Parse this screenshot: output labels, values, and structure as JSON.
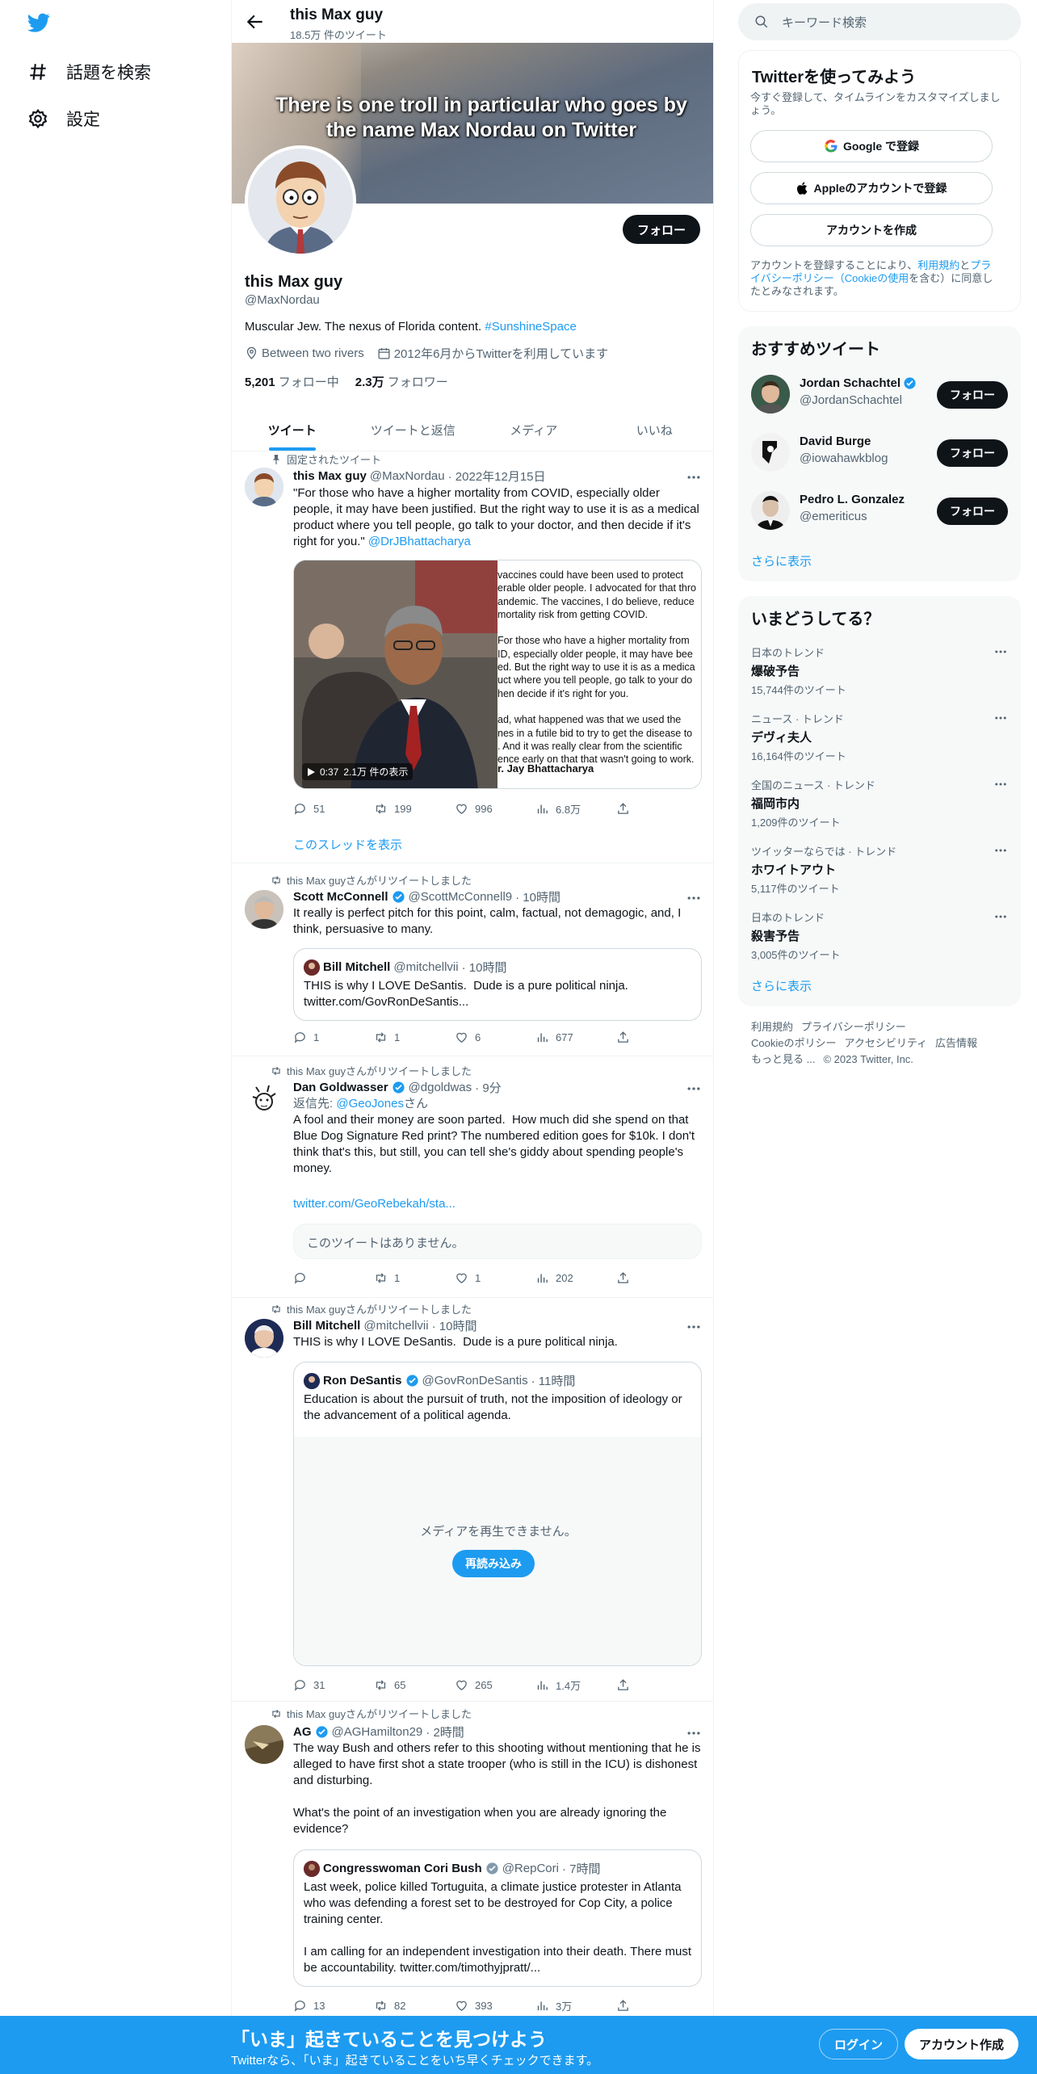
{
  "nav": {
    "explore_label": "話題を検索",
    "settings_label": "設定"
  },
  "profile": {
    "name": "this Max guy",
    "tweet_count": "18.5万 件のツイート",
    "banner_text": "There is one troll in particular who goes by the name Max Nordau on Twitter",
    "follow_label": "フォロー",
    "handle": "@MaxNordau",
    "bio_text": "Muscular Jew. The nexus of Florida content. ",
    "bio_hashtag": "#SunshineSpace",
    "location": "Between two rivers",
    "joined": "2012年6月からTwitterを利用しています",
    "following_count": "5,201",
    "following_label": "フォロー中",
    "followers_count": "2.3万",
    "followers_label": "フォロワー"
  },
  "tabs": [
    "ツイート",
    "ツイートと返信",
    "メディア",
    "いいね"
  ],
  "tweets": [
    {
      "context": "固定されたツイート",
      "name": "this Max guy",
      "handle": "@MaxNordau",
      "time": "· 2022年12月15日",
      "text": "\"For those who have a higher mortality from COVID, especially older people, it may have been justified. But the right way to use it is as a medical product where you tell people, go talk to your doctor, and then decide if it's right for you.\" ",
      "mention": "@DrJBhattacharya",
      "video_quote": "vaccines could have been used to protect\nerable older people. I advocated for that thro\nandemic. The vaccines, I do believe, reduce\nmortality risk from getting COVID.\n\nFor those who have a higher mortality from\nID, especially older people, it may have bee\ned. But the right way to use it is as a medica\nuct where you tell people, go talk to your do\nhen decide if it's right for you.\n\nad, what happened was that we used the\nnes in a futile bid to try to get the disease to\n. And it was really clear from the scientific\nence early on that that wasn't going to work.",
      "video_attrib": "r. Jay Bhattacharya",
      "video_time": "0:37",
      "video_views": "2.1万 件の表示",
      "replies": "51",
      "retweets": "199",
      "likes": "996",
      "views": "6.8万",
      "thread_link": "このスレッドを表示"
    },
    {
      "context": "this Max guyさんがリツイートしました",
      "name": "Scott McConnell",
      "handle": "@ScottMcConnell9",
      "time": "· 10時間",
      "text": "It really is perfect pitch for this point, calm, factual, not demagogic, and, I think, persuasive to many.",
      "quote_name": "Bill Mitchell",
      "quote_handle": "@mitchellvii",
      "quote_time": "· 10時間",
      "quote_text": "THIS is why I LOVE DeSantis.  Dude is a pure political ninja.\ntwitter.com/GovRonDeSantis...",
      "replies": "1",
      "retweets": "1",
      "likes": "6",
      "views": "677"
    },
    {
      "context": "this Max guyさんがリツイートしました",
      "name": "Dan Goldwasser",
      "handle": "@dgoldwas",
      "time": "· 9分",
      "reply_prefix": "返信先: ",
      "reply_to": "@GeoJones",
      "reply_suffix": "さん",
      "text": "A fool and their money are soon parted.  How much did she spend on that Blue Dog Signature Red print? The numbered edition goes for $10k. I don't think that's this, but still, you can tell she's giddy about spending people's money.",
      "link": "twitter.com/GeoRebekah/sta...",
      "unavailable": "このツイートはありません。",
      "replies": "",
      "retweets": "1",
      "likes": "1",
      "views": "202"
    },
    {
      "context": "this Max guyさんがリツイートしました",
      "name": "Bill Mitchell",
      "handle": "@mitchellvii",
      "time": "· 10時間",
      "text": "THIS is why I LOVE DeSantis.  Dude is a pure political ninja.",
      "quote_name": "Ron DeSantis",
      "quote_handle": "@GovRonDeSantis",
      "quote_time": "· 11時間",
      "quote_text": "Education is about the pursuit of truth, not the imposition of ideology or the advancement of a political agenda.",
      "media_error": "メディアを再生できません。",
      "reload_label": "再読み込み",
      "replies": "31",
      "retweets": "65",
      "likes": "265",
      "views": "1.4万"
    },
    {
      "context": "this Max guyさんがリツイートしました",
      "name": "AG",
      "handle": "@AGHamilton29",
      "time": "· 2時間",
      "text": "The way Bush and others refer to this shooting without mentioning that he is alleged to have first shot a state trooper (who is still in the ICU) is dishonest and disturbing.\n\nWhat's the point of an investigation when you are already ignoring the evidence?",
      "quote_name": "Congresswoman Cori Bush",
      "quote_handle": "@RepCori",
      "quote_time": "· 7時間",
      "quote_text": "Last week, police killed Tortuguita, a climate justice protester in Atlanta who was defending a forest set to be destroyed for Cop City, a police training center.\n\nI am calling for an independent investigation into their death. There must be accountability. twitter.com/timothyjpratt/...",
      "replies": "13",
      "retweets": "82",
      "likes": "393",
      "views": "3万"
    }
  ],
  "right": {
    "search_placeholder": "キーワード検索",
    "signup_title": "Twitterを使ってみよう",
    "signup_sub": "今すぐ登録して、タイムラインをカスタマイズしましょう。",
    "google_label": "Google で登録",
    "apple_label": "Appleのアカウントで登録",
    "create_label": "アカウントを作成",
    "terms_pre": "アカウントを登録することにより、",
    "terms_link1": "利用規約",
    "terms_mid": "と",
    "terms_link2": "プライバシーポリシー（Cookieの使用",
    "terms_post": "を含む）に同意したとみなされます。",
    "rec_title": "おすすめツイート",
    "recommendations": [
      {
        "name": "Jordan Schachtel",
        "handle": "@JordanSchachtel",
        "verified": true,
        "follow": "フォロー"
      },
      {
        "name": "David Burge",
        "handle": "@iowahawkblog",
        "verified": false,
        "follow": "フォロー"
      },
      {
        "name": "Pedro L. Gonzalez",
        "handle": "@emeriticus",
        "verified": false,
        "follow": "フォロー"
      }
    ],
    "show_more": "さらに表示",
    "trends_title": "いまどうしてる？",
    "trends": [
      {
        "context": "日本のトレンド",
        "name": "爆破予告",
        "count": "15,744件のツイート"
      },
      {
        "context": "ニュース · トレンド",
        "name": "デヴィ夫人",
        "count": "16,164件のツイート"
      },
      {
        "context": "全国のニュース · トレンド",
        "name": "福岡市内",
        "count": "1,209件のツイート"
      },
      {
        "context": "ツイッターならでは · トレンド",
        "name": "ホワイトアウト",
        "count": "5,117件のツイート"
      },
      {
        "context": "日本のトレンド",
        "name": "殺害予告",
        "count": "3,005件のツイート"
      }
    ],
    "footer_line1": [
      "利用規約",
      "プライバシーポリシー"
    ],
    "footer_line2": [
      "Cookieのポリシー",
      "アクセシビリティ",
      "広告情報"
    ],
    "footer_line3": [
      "もっと見る ...",
      "© 2023 Twitter, Inc."
    ]
  },
  "bottom": {
    "title": "「いま」起きていることを見つけよう",
    "subtitle": "Twitterなら、「いま」起きていることをいち早くチェックできます。",
    "login": "ログイン",
    "signup": "アカウント作成"
  },
  "colors": {
    "accent": "#1d9bf0",
    "text": "#0f1419",
    "muted": "#536471"
  }
}
